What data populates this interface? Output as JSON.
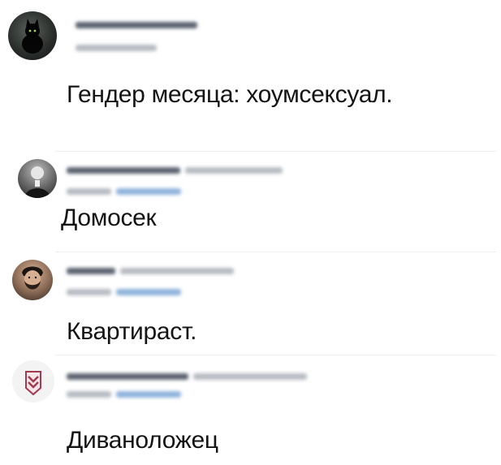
{
  "posts": [
    {
      "author_avatar": "cat-avatar",
      "text": "Гендер месяца: хоумсексуал."
    },
    {
      "author_avatar": "man-portrait-avatar",
      "text": "Домосек"
    },
    {
      "author_avatar": "bearded-man-avatar",
      "text": "Квартираст."
    },
    {
      "author_avatar": "shield-logo-avatar",
      "text": "Диваноложец"
    }
  ],
  "colors": {
    "text": "#141414",
    "blurred_name": "#5c6470",
    "blurred_meta": "#b7bcc3",
    "blurred_link": "#8fb4dc",
    "divider": "#eceff2",
    "logo_accent": "#a23a50"
  }
}
